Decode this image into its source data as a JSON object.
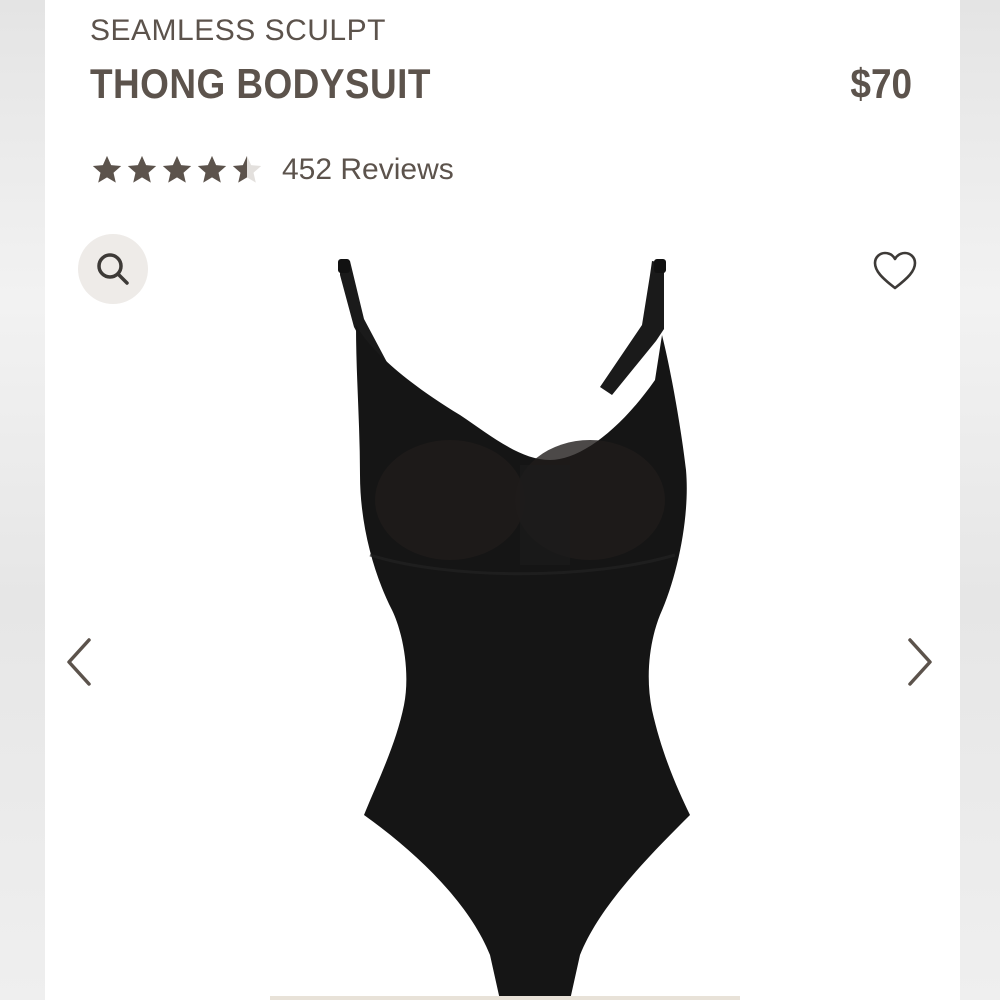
{
  "product": {
    "collection": "SEAMLESS SCULPT",
    "name": "THONG BODYSUIT",
    "price": "$70",
    "rating": 4.5,
    "rating_max": 5,
    "reviews_label": "452 Reviews"
  },
  "icons": {
    "zoom": "search-icon",
    "wishlist": "heart-outline-icon",
    "prev": "chevron-left-icon",
    "next": "chevron-right-icon"
  },
  "colors": {
    "text": "#5c534c",
    "star": "#5c534c",
    "zoom_bg": "#eeebe8",
    "garment": "#151515"
  }
}
